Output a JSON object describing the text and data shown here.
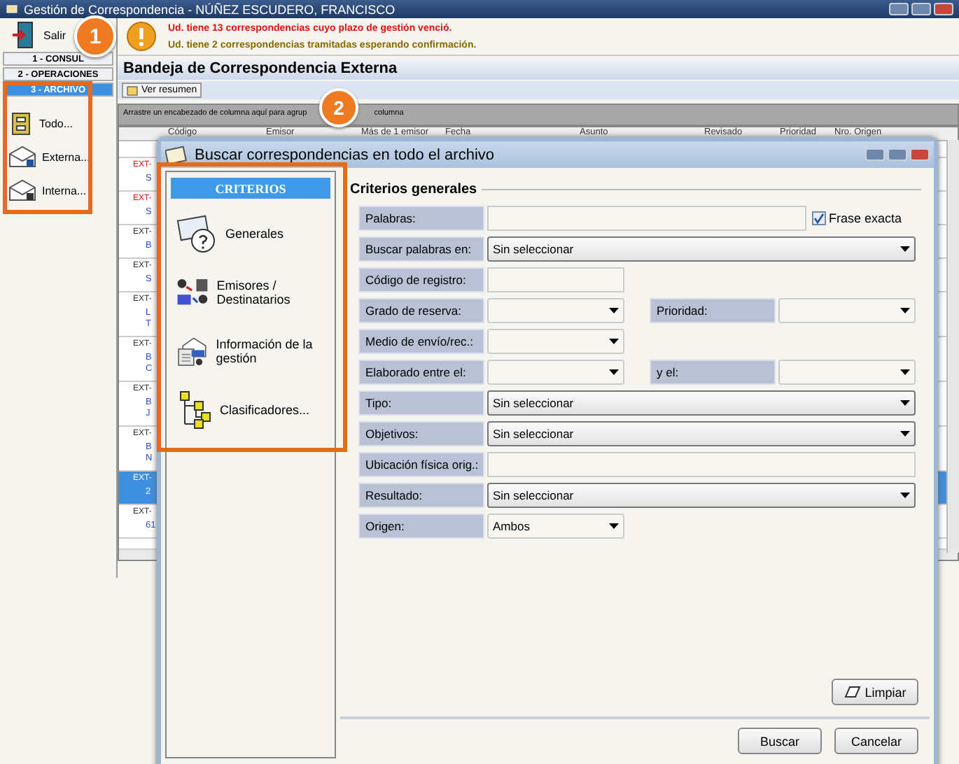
{
  "window": {
    "title": "Gestión de Correspondencia - NÚÑEZ ESCUDERO, FRANCISCO"
  },
  "sidebar": {
    "exit": "Salir",
    "sections": [
      {
        "label": "1 - CONSUL",
        "selected": false
      },
      {
        "label": "2 - OPERACIONES",
        "selected": false
      },
      {
        "label": "3 - ARCHIVO",
        "selected": true
      }
    ],
    "items": [
      {
        "label": "Todo...",
        "kind": "cabinet"
      },
      {
        "label": "Externa...",
        "kind": "external"
      },
      {
        "label": "Interna...",
        "kind": "internal"
      }
    ]
  },
  "alerts": [
    {
      "text": "Ud. tiene 13 correspondencias cuyo plazo de gestión venció.",
      "urgent": true
    },
    {
      "text": "Ud. tiene 2 correspondencias tramitadas esperando confirmación.",
      "urgent": false
    }
  ],
  "inbox": {
    "title": "Bandeja de Correspondencia Externa",
    "summary_button": "Ver resumen",
    "group_hint": "Arrastre un encabezado de columna aquí para agrup",
    "group_hint_end": "columna",
    "columns": [
      "Código",
      "Emisor",
      "Más de 1 emisor",
      "Fecha",
      "Asunto",
      "Revisado",
      "Prioridad",
      "Nro. Origen"
    ],
    "rows": [
      {
        "code": "EXT-",
        "lines": [
          "S"
        ],
        "overdue": true,
        "selected": false
      },
      {
        "code": "EXT-",
        "lines": [
          "S"
        ],
        "overdue": true,
        "selected": false
      },
      {
        "code": "EXT-",
        "lines": [
          "B"
        ],
        "overdue": false,
        "selected": false
      },
      {
        "code": "EXT-",
        "lines": [
          "S"
        ],
        "overdue": false,
        "selected": false
      },
      {
        "code": "EXT-",
        "lines": [
          "L",
          "T"
        ],
        "overdue": false,
        "selected": false
      },
      {
        "code": "EXT-",
        "lines": [
          "B",
          "C"
        ],
        "overdue": false,
        "selected": false
      },
      {
        "code": "EXT-",
        "lines": [
          "B",
          "J"
        ],
        "overdue": false,
        "selected": false
      },
      {
        "code": "EXT-",
        "lines": [
          "B",
          "N"
        ],
        "overdue": false,
        "selected": false
      },
      {
        "code": "EXT-",
        "lines": [
          "2"
        ],
        "overdue": false,
        "selected": true
      },
      {
        "code": "EXT-",
        "lines": [
          "61"
        ],
        "overdue": false,
        "selected": false
      }
    ]
  },
  "dialog": {
    "title": "Buscar correspondencias en todo el archivo",
    "criteria_header": "CRITERIOS",
    "criteria": [
      {
        "label": "Generales",
        "kind": "general"
      },
      {
        "label": "Emisores / Destinatarios",
        "kind": "people"
      },
      {
        "label": "Información de la gestión",
        "kind": "info"
      },
      {
        "label": "Clasificadores...",
        "kind": "tree"
      }
    ],
    "section_title": "Criterios generales",
    "fields": [
      {
        "label": "Palabras:",
        "kind": "text",
        "check": {
          "label": "Frase exacta",
          "checked": true
        }
      },
      {
        "label": "Buscar palabras en:",
        "kind": "select",
        "value": "Sin seleccionar"
      },
      {
        "label": "Código de registro:",
        "kind": "code"
      },
      {
        "label": "Grado de reserva:",
        "kind": "range",
        "second_label": "Prioridad:"
      },
      {
        "label": "Medio de envío/rec.:",
        "kind": "dropdown"
      },
      {
        "label": "Elaborado entre el:",
        "kind": "range",
        "second_label": "y el:"
      },
      {
        "label": "Tipo:",
        "kind": "select",
        "value": "Sin seleccionar"
      },
      {
        "label": "Objetivos:",
        "kind": "select",
        "value": "Sin seleccionar"
      },
      {
        "label": "Ubicación física orig.:",
        "kind": "text"
      },
      {
        "label": "Resultado:",
        "kind": "select",
        "value": "Sin seleccionar"
      },
      {
        "label": "Origen:",
        "kind": "dropdown",
        "value": "Ambos"
      }
    ],
    "clear_button": "Limpiar",
    "search_button": "Buscar",
    "cancel_button": "Cancelar"
  },
  "callouts": [
    {
      "number": "1"
    },
    {
      "number": "2"
    }
  ]
}
